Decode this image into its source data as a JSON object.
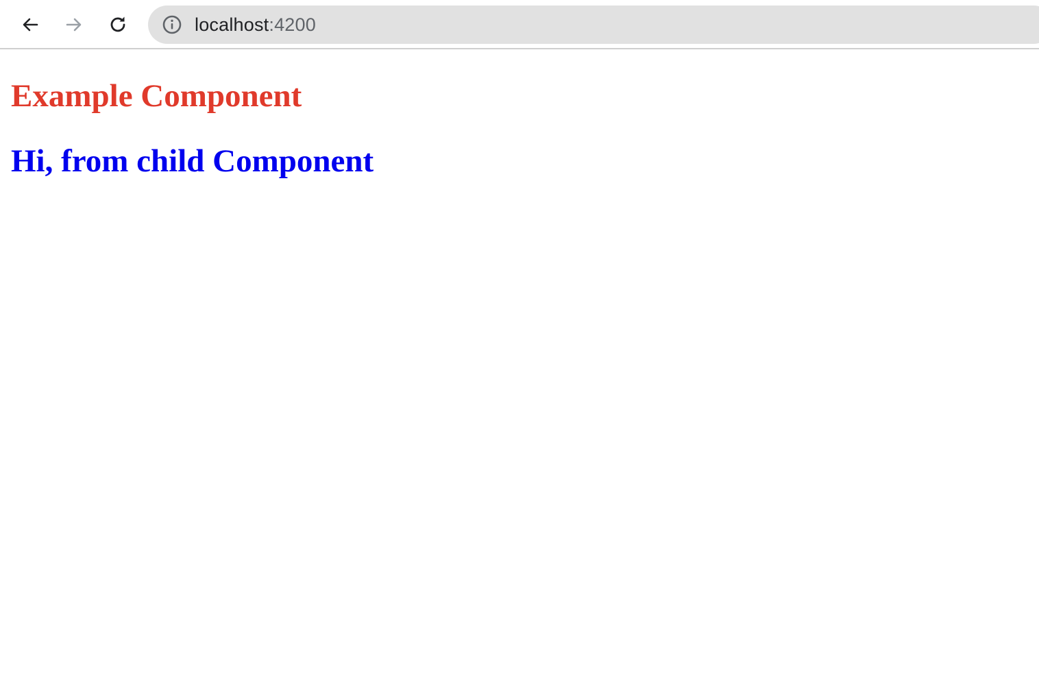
{
  "browser": {
    "back_icon": "arrow-left-icon",
    "forward_icon": "arrow-right-icon",
    "reload_icon": "reload-icon",
    "info_icon": "info-circle-icon",
    "url_host": "localhost",
    "url_port": ":4200"
  },
  "page": {
    "parent_heading": "Example Component",
    "child_heading": "Hi, from child Component",
    "colors": {
      "parent_heading": "#e03a2b",
      "child_heading": "#0000ee"
    }
  }
}
